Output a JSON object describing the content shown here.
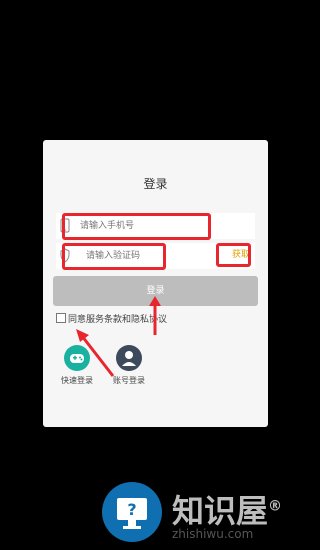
{
  "dialog": {
    "title": "登录",
    "phone_placeholder": "请输入手机号",
    "code_placeholder": "请输入验证码",
    "get_code_label": "获取",
    "login_label": "登录",
    "agreement_text": "同意服务条款和隐私协议",
    "options": [
      {
        "label": "快速登录",
        "icon": "gamepad-icon"
      },
      {
        "label": "账号登录",
        "icon": "person-icon"
      }
    ]
  },
  "watermark": {
    "brand": "知识屋",
    "url": "zhishiwu.com",
    "registered": "®"
  },
  "colors": {
    "highlight": "#e8262d",
    "accent": "#e2a100",
    "quick_login": "#1bb1a0",
    "account_login": "#3d4a5c",
    "watermark_blue": "#0f6fb0"
  }
}
